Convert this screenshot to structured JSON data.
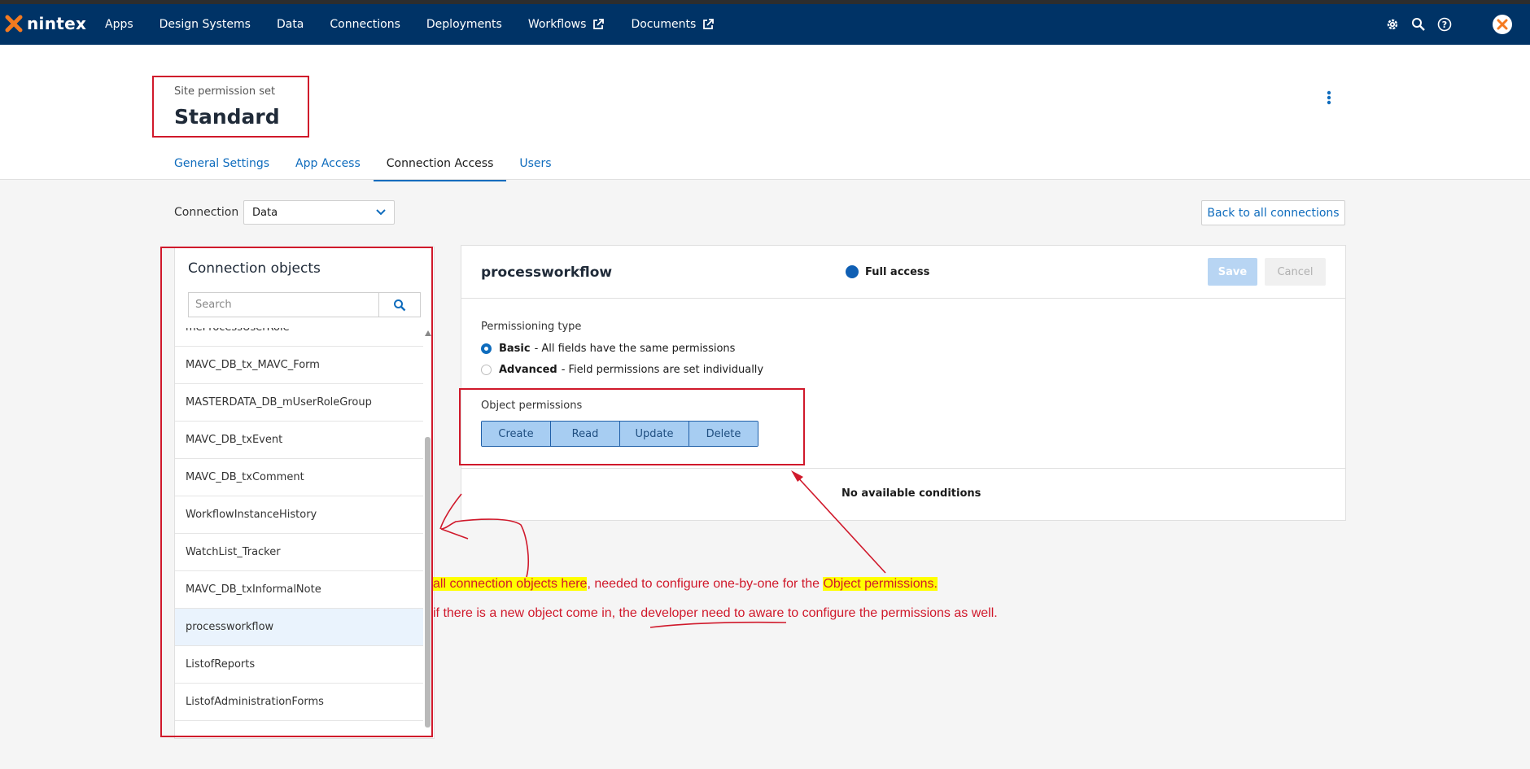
{
  "app": {
    "brand": "nintex",
    "nav": [
      {
        "label": "Apps"
      },
      {
        "label": "Design Systems"
      },
      {
        "label": "Data"
      },
      {
        "label": "Connections"
      },
      {
        "label": "Deployments"
      },
      {
        "label": "Workflows",
        "external": true
      },
      {
        "label": "Documents",
        "external": true
      }
    ],
    "top_icons": [
      "gear-icon",
      "search-icon",
      "help-icon",
      "user-avatar-icon"
    ],
    "colors": {
      "topbar": "#003366",
      "accent": "#0f6cbd",
      "annotation": "#d0192b",
      "highlight": "#ffff00"
    }
  },
  "page": {
    "subtitle": "Site permission set",
    "title": "Standard",
    "tabs": [
      {
        "label": "General Settings",
        "active": false
      },
      {
        "label": "App Access",
        "active": false
      },
      {
        "label": "Connection Access",
        "active": true
      },
      {
        "label": "Users",
        "active": false
      }
    ]
  },
  "connection": {
    "label": "Connection",
    "selected": "Data",
    "back_button": "Back to all connections"
  },
  "objects_panel": {
    "title": "Connection objects",
    "search_placeholder": "Search",
    "items": [
      {
        "label": "meProcessUserRole"
      },
      {
        "label": "MAVC_DB_tx_MAVC_Form"
      },
      {
        "label": "MASTERDATA_DB_mUserRoleGroup"
      },
      {
        "label": "MAVC_DB_txEvent"
      },
      {
        "label": "MAVC_DB_txComment"
      },
      {
        "label": "WorkflowInstanceHistory"
      },
      {
        "label": "WatchList_Tracker"
      },
      {
        "label": "MAVC_DB_txInformalNote"
      },
      {
        "label": "processworkflow",
        "selected": true
      },
      {
        "label": "ListofReports"
      },
      {
        "label": "ListofAdministrationForms"
      }
    ]
  },
  "detail": {
    "object_name": "processworkflow",
    "access_label": "Full access",
    "save": "Save",
    "cancel": "Cancel",
    "permissioning_type_label": "Permissioning type",
    "options": [
      {
        "bold": "Basic",
        "desc": "- All fields have the same permissions",
        "checked": true
      },
      {
        "bold": "Advanced",
        "desc": "- Field permissions are set individually",
        "checked": false
      }
    ],
    "object_permissions_label": "Object permissions",
    "permission_buttons": [
      "Create",
      "Read",
      "Update",
      "Delete"
    ],
    "no_conditions": "No available conditions"
  },
  "annotations": {
    "line1_hl1": "all connection objects here",
    "line1_mid": ", needed to configure one-by-one for the ",
    "line1_hl2": "Object permissions.",
    "line2": "if there is a new object come in, the developer need to aware to configure the permissions as well."
  }
}
